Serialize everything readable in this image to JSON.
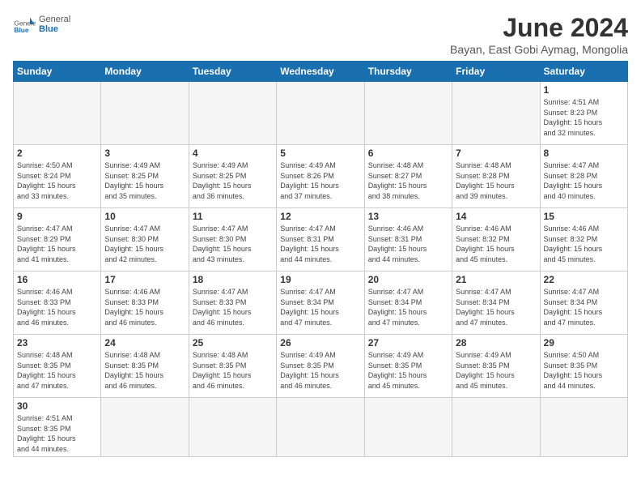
{
  "header": {
    "logo_general": "General",
    "logo_blue": "Blue",
    "title": "June 2024",
    "subtitle": "Bayan, East Gobi Aymag, Mongolia"
  },
  "weekdays": [
    "Sunday",
    "Monday",
    "Tuesday",
    "Wednesday",
    "Thursday",
    "Friday",
    "Saturday"
  ],
  "weeks": [
    [
      {
        "day": "",
        "info": ""
      },
      {
        "day": "",
        "info": ""
      },
      {
        "day": "",
        "info": ""
      },
      {
        "day": "",
        "info": ""
      },
      {
        "day": "",
        "info": ""
      },
      {
        "day": "",
        "info": ""
      },
      {
        "day": "1",
        "info": "Sunrise: 4:51 AM\nSunset: 8:23 PM\nDaylight: 15 hours\nand 32 minutes."
      }
    ],
    [
      {
        "day": "2",
        "info": "Sunrise: 4:50 AM\nSunset: 8:24 PM\nDaylight: 15 hours\nand 33 minutes."
      },
      {
        "day": "3",
        "info": "Sunrise: 4:49 AM\nSunset: 8:25 PM\nDaylight: 15 hours\nand 35 minutes."
      },
      {
        "day": "4",
        "info": "Sunrise: 4:49 AM\nSunset: 8:25 PM\nDaylight: 15 hours\nand 36 minutes."
      },
      {
        "day": "5",
        "info": "Sunrise: 4:49 AM\nSunset: 8:26 PM\nDaylight: 15 hours\nand 37 minutes."
      },
      {
        "day": "6",
        "info": "Sunrise: 4:48 AM\nSunset: 8:27 PM\nDaylight: 15 hours\nand 38 minutes."
      },
      {
        "day": "7",
        "info": "Sunrise: 4:48 AM\nSunset: 8:28 PM\nDaylight: 15 hours\nand 39 minutes."
      },
      {
        "day": "8",
        "info": "Sunrise: 4:47 AM\nSunset: 8:28 PM\nDaylight: 15 hours\nand 40 minutes."
      }
    ],
    [
      {
        "day": "9",
        "info": "Sunrise: 4:47 AM\nSunset: 8:29 PM\nDaylight: 15 hours\nand 41 minutes."
      },
      {
        "day": "10",
        "info": "Sunrise: 4:47 AM\nSunset: 8:30 PM\nDaylight: 15 hours\nand 42 minutes."
      },
      {
        "day": "11",
        "info": "Sunrise: 4:47 AM\nSunset: 8:30 PM\nDaylight: 15 hours\nand 43 minutes."
      },
      {
        "day": "12",
        "info": "Sunrise: 4:47 AM\nSunset: 8:31 PM\nDaylight: 15 hours\nand 44 minutes."
      },
      {
        "day": "13",
        "info": "Sunrise: 4:46 AM\nSunset: 8:31 PM\nDaylight: 15 hours\nand 44 minutes."
      },
      {
        "day": "14",
        "info": "Sunrise: 4:46 AM\nSunset: 8:32 PM\nDaylight: 15 hours\nand 45 minutes."
      },
      {
        "day": "15",
        "info": "Sunrise: 4:46 AM\nSunset: 8:32 PM\nDaylight: 15 hours\nand 45 minutes."
      }
    ],
    [
      {
        "day": "16",
        "info": "Sunrise: 4:46 AM\nSunset: 8:33 PM\nDaylight: 15 hours\nand 46 minutes."
      },
      {
        "day": "17",
        "info": "Sunrise: 4:46 AM\nSunset: 8:33 PM\nDaylight: 15 hours\nand 46 minutes."
      },
      {
        "day": "18",
        "info": "Sunrise: 4:47 AM\nSunset: 8:33 PM\nDaylight: 15 hours\nand 46 minutes."
      },
      {
        "day": "19",
        "info": "Sunrise: 4:47 AM\nSunset: 8:34 PM\nDaylight: 15 hours\nand 47 minutes."
      },
      {
        "day": "20",
        "info": "Sunrise: 4:47 AM\nSunset: 8:34 PM\nDaylight: 15 hours\nand 47 minutes."
      },
      {
        "day": "21",
        "info": "Sunrise: 4:47 AM\nSunset: 8:34 PM\nDaylight: 15 hours\nand 47 minutes."
      },
      {
        "day": "22",
        "info": "Sunrise: 4:47 AM\nSunset: 8:34 PM\nDaylight: 15 hours\nand 47 minutes."
      }
    ],
    [
      {
        "day": "23",
        "info": "Sunrise: 4:48 AM\nSunset: 8:35 PM\nDaylight: 15 hours\nand 47 minutes."
      },
      {
        "day": "24",
        "info": "Sunrise: 4:48 AM\nSunset: 8:35 PM\nDaylight: 15 hours\nand 46 minutes."
      },
      {
        "day": "25",
        "info": "Sunrise: 4:48 AM\nSunset: 8:35 PM\nDaylight: 15 hours\nand 46 minutes."
      },
      {
        "day": "26",
        "info": "Sunrise: 4:49 AM\nSunset: 8:35 PM\nDaylight: 15 hours\nand 46 minutes."
      },
      {
        "day": "27",
        "info": "Sunrise: 4:49 AM\nSunset: 8:35 PM\nDaylight: 15 hours\nand 45 minutes."
      },
      {
        "day": "28",
        "info": "Sunrise: 4:49 AM\nSunset: 8:35 PM\nDaylight: 15 hours\nand 45 minutes."
      },
      {
        "day": "29",
        "info": "Sunrise: 4:50 AM\nSunset: 8:35 PM\nDaylight: 15 hours\nand 44 minutes."
      }
    ],
    [
      {
        "day": "30",
        "info": "Sunrise: 4:51 AM\nSunset: 8:35 PM\nDaylight: 15 hours\nand 44 minutes."
      },
      {
        "day": "",
        "info": ""
      },
      {
        "day": "",
        "info": ""
      },
      {
        "day": "",
        "info": ""
      },
      {
        "day": "",
        "info": ""
      },
      {
        "day": "",
        "info": ""
      },
      {
        "day": "",
        "info": ""
      }
    ]
  ]
}
